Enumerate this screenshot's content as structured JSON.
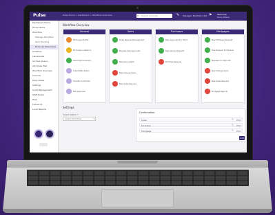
{
  "app": {
    "logo": "Pulse"
  },
  "topbar": {
    "breadcrumbs": "Pulse Home  >  Dashboard  >  Workflow Overview",
    "search_placeholder": "Search modules",
    "role": "Manager, Northern Unit",
    "user_name": "Welcome",
    "user_sub": "Dana Weber"
  },
  "sidebar": {
    "items": [
      {
        "label": "Dashboard Home",
        "active": false,
        "sub": false
      },
      {
        "label": "Home Items",
        "active": false,
        "sub": false
      },
      {
        "label": "Workflow",
        "active": false,
        "sub": false
      },
      {
        "label": "Manage Workflow",
        "active": false,
        "sub": true
      },
      {
        "label": "Item Tracking",
        "active": false,
        "sub": true
      },
      {
        "label": "Process Overview",
        "active": true,
        "sub": true
      },
      {
        "label": "Analytics",
        "active": false,
        "sub": false
      },
      {
        "label": "Lab Results",
        "active": false,
        "sub": false
      },
      {
        "label": "Archive Queue",
        "active": false,
        "sub": false
      },
      {
        "label": "Add Case Plan",
        "active": false,
        "sub": false
      },
      {
        "label": "Workflow Overview",
        "active": false,
        "sub": false
      },
      {
        "label": "Invoices",
        "active": false,
        "sub": false
      },
      {
        "label": "Daily Notes",
        "active": false,
        "sub": false
      },
      {
        "label": "Settings",
        "active": false,
        "sub": false
      },
      {
        "label": "Audit Management",
        "active": false,
        "sub": false
      },
      {
        "label": "Staff Roster",
        "active": false,
        "sub": false
      },
      {
        "label": "Help",
        "active": false,
        "sub": false
      },
      {
        "label": "Follow Up",
        "active": false,
        "sub": false
      },
      {
        "label": "Local Reports",
        "active": false,
        "sub": false
      }
    ]
  },
  "main": {
    "page_title": "Workflow Overview",
    "columns": [
      {
        "title": "General",
        "nodes": [
          {
            "label": "Exchange Facility",
            "color": "#e8892c"
          },
          {
            "label": "Exchange & Returns",
            "color": "#e9b321"
          },
          {
            "label": "Exchange Of Orders",
            "color": "#3fae4b"
          },
          {
            "label": "Credit Note Return",
            "color": "#b7a8de"
          },
          {
            "label": "Transfer Confirmed",
            "color": "#b7a8de"
          },
          {
            "label": "Not Approved",
            "color": "#b7a8de"
          }
        ]
      },
      {
        "title": "Sales",
        "nodes": [
          {
            "label": "Sales Request Management",
            "color": "#3fae4b"
          },
          {
            "label": "Request Sale Approvals",
            "color": "#3fae4b"
          },
          {
            "label": "New Item Added",
            "color": "#3fae4b"
          },
          {
            "label": "New Change Items",
            "color": "#e0443a"
          },
          {
            "label": "New Sales Request",
            "color": "#e0443a"
          }
        ]
      },
      {
        "title": "Purchases",
        "nodes": [
          {
            "label": "New Approvals For Stock",
            "color": "#3fae4b"
          },
          {
            "label": "New Vendor Request",
            "color": "#3fae4b"
          },
          {
            "label": "Purchase Request",
            "color": "#e0443a"
          }
        ]
      },
      {
        "title": "Mortgages",
        "nodes": [
          {
            "label": "New Mortgage Request",
            "color": "#3fae4b"
          },
          {
            "label": "New Request For Review",
            "color": "#3fae4b"
          },
          {
            "label": "Request For Approval",
            "color": "#3fae4b"
          },
          {
            "label": "New Change Items",
            "color": "#e0443a"
          },
          {
            "label": "New Sales Request",
            "color": "#e0443a"
          },
          {
            "label": "Mortgage Reports",
            "color": "#e0443a"
          }
        ]
      }
    ],
    "settings_title": "Settings",
    "select_label": "Select Option *",
    "select_value": "Select Workflow",
    "card": {
      "title": "Confirmation",
      "rows": [
        {
          "text": "Sales",
          "link": "Edit"
        },
        {
          "text": "Purchase",
          "link": "Edit"
        },
        {
          "text": "Mortgage",
          "link": "Edit"
        }
      ],
      "add_label": "Add"
    }
  }
}
